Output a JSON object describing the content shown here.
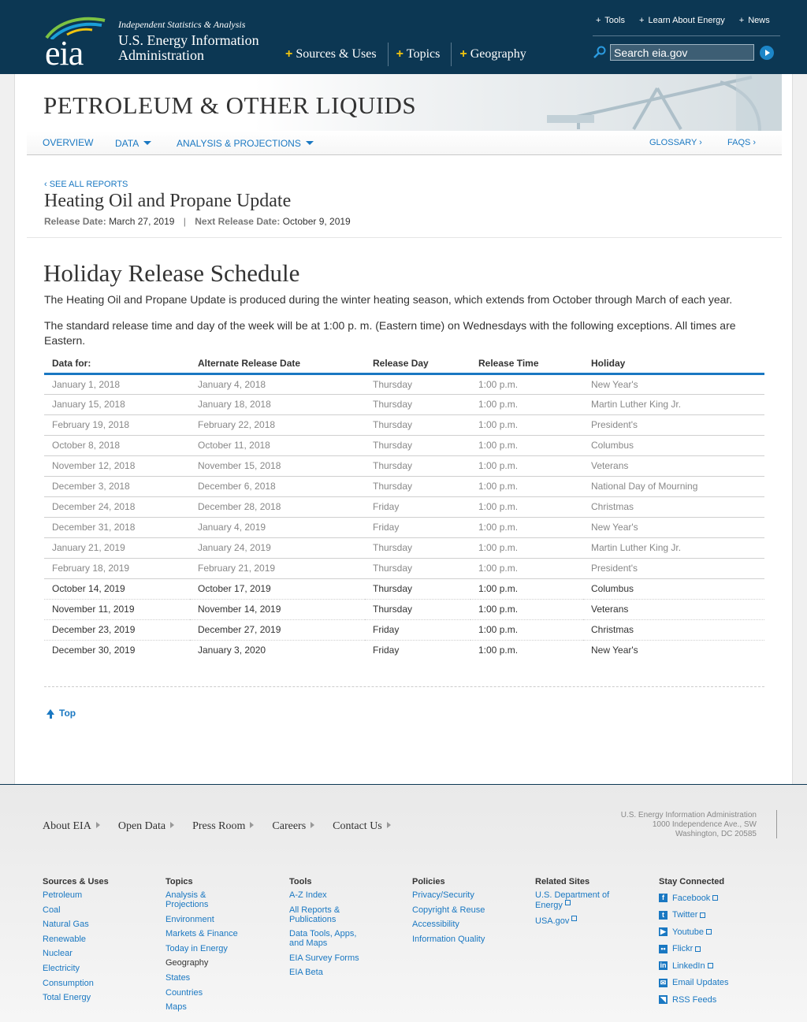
{
  "header": {
    "logo_text": "eia",
    "tagline": "Independent Statistics & Analysis",
    "agency_line1": "U.S. Energy Information",
    "agency_line2": "Administration",
    "main_nav": [
      "Sources & Uses",
      "Topics",
      "Geography"
    ],
    "util_nav": [
      "Tools",
      "Learn About Energy",
      "News"
    ],
    "search_placeholder": "Search eia.gov"
  },
  "section": {
    "title": "PETROLEUM & OTHER LIQUIDS",
    "subnav": {
      "overview": "OVERVIEW",
      "data": "DATA",
      "analysis": "ANALYSIS & PROJECTIONS",
      "glossary": "GLOSSARY ›",
      "faqs": "FAQS ›"
    }
  },
  "report": {
    "see_all": "‹ SEE ALL REPORTS",
    "title": "Heating Oil and Propane Update",
    "release_label": "Release Date:",
    "release_date": "March 27, 2019",
    "separator": "|",
    "next_label": "Next Release Date:",
    "next_date": "October 9, 2019"
  },
  "schedule": {
    "heading": "Holiday Release Schedule",
    "intro": "The Heating Oil and Propane Update is produced during the winter heating season, which extends from October through March of each year.",
    "note": "The standard release time and day of the week will be at 1:00 p. m. (Eastern time) on Wednesdays with the following exceptions. All times are Eastern.",
    "columns": [
      "Data for:",
      "Alternate Release Date",
      "Release Day",
      "Release Time",
      "Holiday"
    ],
    "rows": [
      [
        "January 1, 2018",
        "January 4, 2018",
        "Thursday",
        "1:00 p.m.",
        "New Year's"
      ],
      [
        "January 15, 2018",
        "January 18, 2018",
        "Thursday",
        "1:00 p.m.",
        "Martin Luther King Jr."
      ],
      [
        "February 19, 2018",
        "February 22, 2018",
        "Thursday",
        "1:00 p.m.",
        "President's"
      ],
      [
        "October 8, 2018",
        "October 11, 2018",
        "Thursday",
        "1:00 p.m.",
        "Columbus"
      ],
      [
        "November 12, 2018",
        "November 15, 2018",
        "Thursday",
        "1:00 p.m.",
        "Veterans"
      ],
      [
        "December 3, 2018",
        "December 6, 2018",
        "Thursday",
        "1:00 p.m.",
        "National Day of Mourning"
      ],
      [
        "December 24, 2018",
        "December 28, 2018",
        "Friday",
        "1:00 p.m.",
        "Christmas"
      ],
      [
        "December 31, 2018",
        "January 4, 2019",
        "Friday",
        "1:00 p.m.",
        "New Year's"
      ],
      [
        "January 21, 2019",
        "January 24, 2019",
        "Thursday",
        "1:00 p.m.",
        "Martin Luther King Jr."
      ],
      [
        "February 18, 2019",
        "February 21, 2019",
        "Thursday",
        "1:00 p.m.",
        "President's"
      ],
      [
        "October 14, 2019",
        "October 17, 2019",
        "Thursday",
        "1:00 p.m.",
        "Columbus"
      ],
      [
        "November 11, 2019",
        "November 14, 2019",
        "Thursday",
        "1:00 p.m.",
        "Veterans"
      ],
      [
        "December 23, 2019",
        "December 27, 2019",
        "Friday",
        "1:00 p.m.",
        "Christmas"
      ],
      [
        "December 30, 2019",
        "January 3, 2020",
        "Friday",
        "1:00 p.m.",
        "New Year's"
      ]
    ],
    "past_row_count": 10,
    "top_link": "Top"
  },
  "footer": {
    "nav": [
      "About EIA",
      "Open Data",
      "Press Room",
      "Careers",
      "Contact Us"
    ],
    "address": [
      "U.S. Energy Information Administration",
      "1000 Independence Ave., SW",
      "Washington, DC 20585"
    ],
    "columns": [
      {
        "head": "Sources & Uses",
        "links": [
          "Petroleum",
          "Coal",
          "Natural Gas",
          "Renewable",
          "Nuclear",
          "Electricity",
          "Consumption",
          "Total Energy"
        ]
      },
      {
        "head": "Topics",
        "links": [
          "Analysis & Projections",
          "Environment",
          "Markets & Finance",
          "Today in Energy"
        ],
        "subhead": "Geography",
        "sublinks": [
          "States",
          "Countries",
          "Maps"
        ]
      },
      {
        "head": "Tools",
        "links": [
          "A-Z Index",
          "All Reports & Publications",
          "Data Tools, Apps, and Maps",
          "EIA Survey Forms",
          "EIA Beta"
        ]
      },
      {
        "head": "Policies",
        "links": [
          "Privacy/Security",
          "Copyright & Reuse",
          "Accessibility",
          "Information Quality"
        ]
      },
      {
        "head": "Related Sites",
        "links": [
          "U.S. Department of Energy",
          "USA.gov"
        ]
      }
    ],
    "social_head": "Stay Connected",
    "social": [
      {
        "label": "Facebook",
        "icon": "facebook-icon",
        "glyph": "f"
      },
      {
        "label": "Twitter",
        "icon": "twitter-icon",
        "glyph": "t"
      },
      {
        "label": "Youtube",
        "icon": "youtube-icon",
        "glyph": "▶"
      },
      {
        "label": "Flickr",
        "icon": "flickr-icon",
        "glyph": "••"
      },
      {
        "label": "LinkedIn",
        "icon": "linkedin-icon",
        "glyph": "in"
      },
      {
        "label": "Email Updates",
        "icon": "email-icon",
        "glyph": "✉"
      },
      {
        "label": "RSS Feeds",
        "icon": "rss-icon",
        "glyph": "◥"
      }
    ]
  },
  "colors": {
    "header_bg": "#0c3753",
    "accent_blue": "#1a78c2",
    "plus_yellow": "#f1c40f"
  }
}
